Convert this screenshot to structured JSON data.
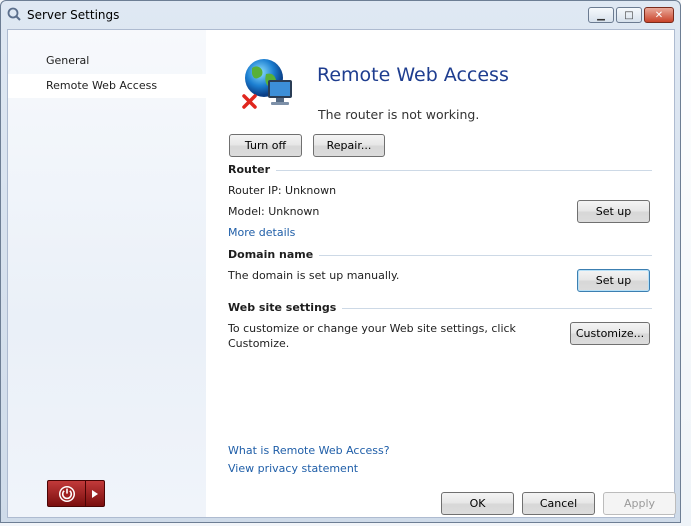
{
  "window": {
    "title": "Server Settings",
    "controls": {
      "minimize": "▁",
      "maximize": "□",
      "close": "✕"
    }
  },
  "sidebar": {
    "items": [
      {
        "label": "General",
        "selected": false
      },
      {
        "label": "Remote Web Access",
        "selected": true
      }
    ]
  },
  "main": {
    "title": "Remote Web Access",
    "status": "The router is not working.",
    "turn_off_label": "Turn off",
    "repair_label": "Repair...",
    "router": {
      "heading": "Router",
      "ip": "Router IP: Unknown",
      "model": "Model: Unknown",
      "more_details": "More details",
      "setup_label": "Set up"
    },
    "domain": {
      "heading": "Domain name",
      "text": "The domain is set up manually.",
      "setup_label": "Set up"
    },
    "website": {
      "heading": "Web site settings",
      "text": "To customize or change your Web site settings, click Customize.",
      "customize_label": "Customize..."
    },
    "links": {
      "what_is": "What is Remote Web Access?",
      "privacy": "View privacy statement"
    }
  },
  "footer": {
    "ok": "OK",
    "cancel": "Cancel",
    "apply": "Apply"
  },
  "colors": {
    "title": "#1e3d8f",
    "link": "#1f5ea8",
    "power": "#a01e1e"
  },
  "icons": [
    "server-settings-icon",
    "remote-web-access-globe-icon",
    "error-x-icon",
    "power-icon",
    "arrow-right-icon"
  ]
}
